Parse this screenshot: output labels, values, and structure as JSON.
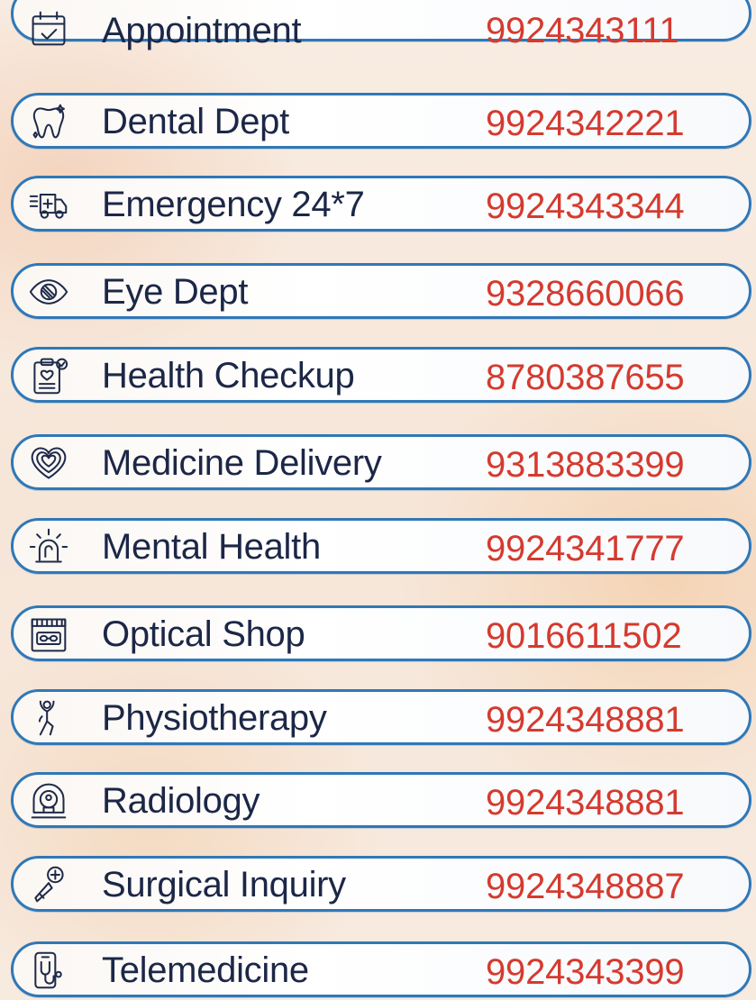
{
  "colors": {
    "border": "#2f78b8",
    "label": "#1c2747",
    "phone": "#d53a2f",
    "icon": "#1e2a4a"
  },
  "contacts": [
    {
      "label": "Appointment",
      "phone": "9924343111",
      "icon": "calendar-check-icon"
    },
    {
      "label": "Dental Dept",
      "phone": "9924342221",
      "icon": "tooth-icon"
    },
    {
      "label": "Emergency 24*7",
      "phone": "9924343344",
      "icon": "ambulance-icon"
    },
    {
      "label": "Eye Dept",
      "phone": "9328660066",
      "icon": "eye-icon"
    },
    {
      "label": "Health Checkup",
      "phone": "8780387655",
      "icon": "clipboard-heart-icon"
    },
    {
      "label": "Medicine Delivery",
      "phone": "9313883399",
      "icon": "heart-icon"
    },
    {
      "label": "Mental Health",
      "phone": "9924341777",
      "icon": "alarm-light-icon"
    },
    {
      "label": "Optical Shop",
      "phone": "9016611502",
      "icon": "glasses-shop-icon"
    },
    {
      "label": "Physiotherapy",
      "phone": "9924348881",
      "icon": "person-stretch-icon"
    },
    {
      "label": "Radiology",
      "phone": "9924348881",
      "icon": "mri-scanner-icon"
    },
    {
      "label": "Surgical Inquiry",
      "phone": "9924348887",
      "icon": "scalpel-icon"
    },
    {
      "label": "Telemedicine",
      "phone": "9924343399",
      "icon": "phone-stethoscope-icon"
    }
  ]
}
